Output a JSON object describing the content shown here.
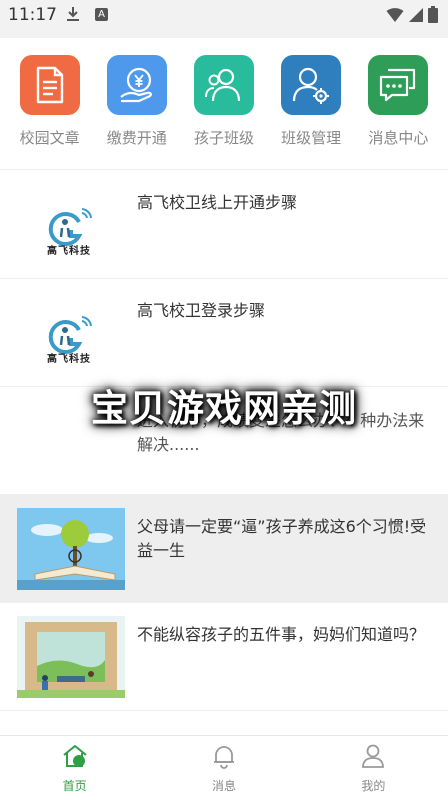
{
  "status_bar": {
    "time": "11:17",
    "badge": "A"
  },
  "quick_menu": [
    {
      "label": "校园文章",
      "icon": "document-icon",
      "color": "#f06a43"
    },
    {
      "label": "缴费开通",
      "icon": "payment-hand-icon",
      "color": "#4f99ec"
    },
    {
      "label": "孩子班级",
      "icon": "children-icon",
      "color": "#28bc9c"
    },
    {
      "label": "班级管理",
      "icon": "user-settings-icon",
      "color": "#2f7fbf"
    },
    {
      "label": "消息中心",
      "icon": "message-icon",
      "color": "#2e9d57"
    }
  ],
  "news": [
    {
      "title": "高飞校卫线上开通步骤",
      "thumb": "gaofei-logo",
      "logo_text": "高飞科技"
    },
    {
      "title": "高飞校卫登录步骤",
      "thumb": "gaofei-logo",
      "logo_text": "高飞科技"
    },
    {
      "title": "进入初中，成绩变差怎么办？4 种办法来解决......",
      "thumb": "none"
    },
    {
      "title": "父母请一定要“逼”孩子养成这6个习惯!受益一生",
      "thumb": "tree-book-illustration"
    },
    {
      "title": "不能纵容孩子的五件事，妈妈们知道吗？",
      "thumb": "park-illustration"
    }
  ],
  "watermark": "宝贝游戏网亲测",
  "bottom_nav": [
    {
      "label": "首页",
      "icon": "home-icon",
      "active": true
    },
    {
      "label": "消息",
      "icon": "bell-icon",
      "active": false
    },
    {
      "label": "我的",
      "icon": "profile-icon",
      "active": false
    }
  ],
  "colors": {
    "accent": "#2f9e44",
    "tile_text": "#888888"
  }
}
